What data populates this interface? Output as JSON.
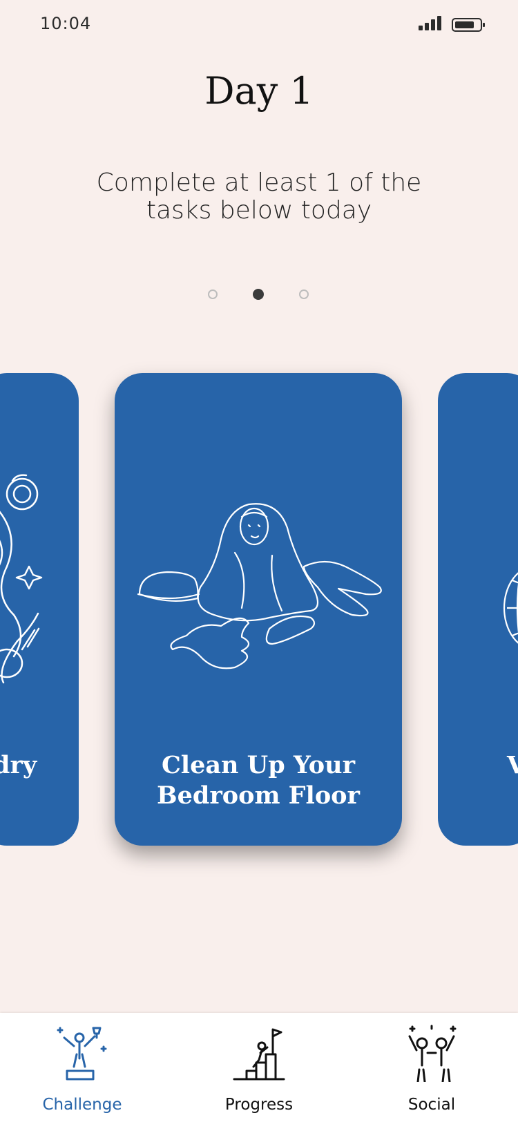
{
  "status_bar": {
    "time": "10:04",
    "icons": [
      "signal-icon",
      "battery-icon"
    ]
  },
  "header": {
    "title": "Day 1",
    "instructions": "Complete at least 1 of the tasks below today"
  },
  "pager": {
    "count": 3,
    "active_index": 1
  },
  "cards": [
    {
      "title_fragment": "dry",
      "icon": "laundry-illustration-icon"
    },
    {
      "title": "Clean Up Your Bedroom Floor",
      "icon": "bedroom-floor-illustration-icon"
    },
    {
      "title_fragment": "V",
      "icon": "globe-illustration-icon"
    }
  ],
  "bottom_nav": {
    "items": [
      {
        "label": "Challenge",
        "icon": "trophy-podium-icon",
        "active": true
      },
      {
        "label": "Progress",
        "icon": "climb-steps-flag-icon",
        "active": false
      },
      {
        "label": "Social",
        "icon": "friends-celebrate-icon",
        "active": false
      }
    ]
  },
  "colors": {
    "background": "#f9efec",
    "card": "#2764a9",
    "active_nav": "#2764a9",
    "dot_active": "#3b3b3b",
    "dot_inactive": "#bdbdbd"
  }
}
